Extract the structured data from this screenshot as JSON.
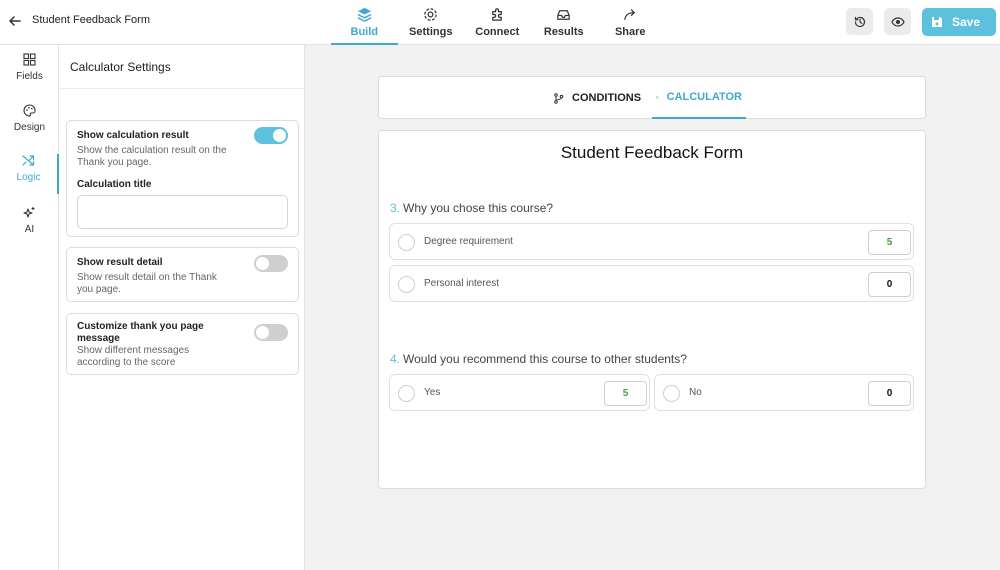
{
  "header": {
    "form_title": "Student Feedback Form",
    "nav": [
      {
        "label": "Build",
        "active": true
      },
      {
        "label": "Settings",
        "active": false
      },
      {
        "label": "Connect",
        "active": false
      },
      {
        "label": "Results",
        "active": false
      },
      {
        "label": "Share",
        "active": false
      }
    ],
    "save_label": "Save"
  },
  "rail": [
    {
      "label": "Fields",
      "icon": "grid-icon"
    },
    {
      "label": "Design",
      "icon": "palette-icon"
    },
    {
      "label": "Logic",
      "icon": "shuffle-icon",
      "active": true
    },
    {
      "label": "AI",
      "icon": "sparkles-icon"
    }
  ],
  "panel": {
    "title": "Calculator Settings",
    "cards": [
      {
        "title": "Show calculation result",
        "desc_line1": "Show the calculation result on the",
        "desc_line2": "Thank you page.",
        "toggle": "on"
      },
      {
        "title": "Show result detail",
        "desc_line1": "Show result detail on the Thank",
        "desc_line2": "you page.",
        "toggle": "off"
      },
      {
        "title_line1": "Customize thank you page",
        "title_line2": "message",
        "desc_line1": "Show different messages",
        "desc_line2": "according to the score",
        "toggle": "off"
      }
    ],
    "calc_title_label": "Calculation title",
    "calc_title_value": ""
  },
  "tabs": [
    {
      "label": "CONDITIONS",
      "icon": "branch-icon",
      "active": false
    },
    {
      "label": "CALCULATOR",
      "icon": "calculator-icon",
      "active": true
    }
  ],
  "form": {
    "heading": "Student Feedback Form",
    "q3": {
      "number": "3.",
      "text": "Why you chose this course?",
      "options": [
        {
          "label": "Degree requirement",
          "score": "5"
        },
        {
          "label": "Personal interest",
          "score": "0"
        }
      ]
    },
    "q4": {
      "number": "4.",
      "text": "Would you recommend this course to other students?",
      "options": [
        {
          "label": "Yes",
          "score": "5"
        },
        {
          "label": "No",
          "score": "0"
        }
      ]
    }
  },
  "colors": {
    "accent": "#5dc1dd",
    "active_text": "#3fa9cc",
    "positive_score": "#43a047"
  }
}
